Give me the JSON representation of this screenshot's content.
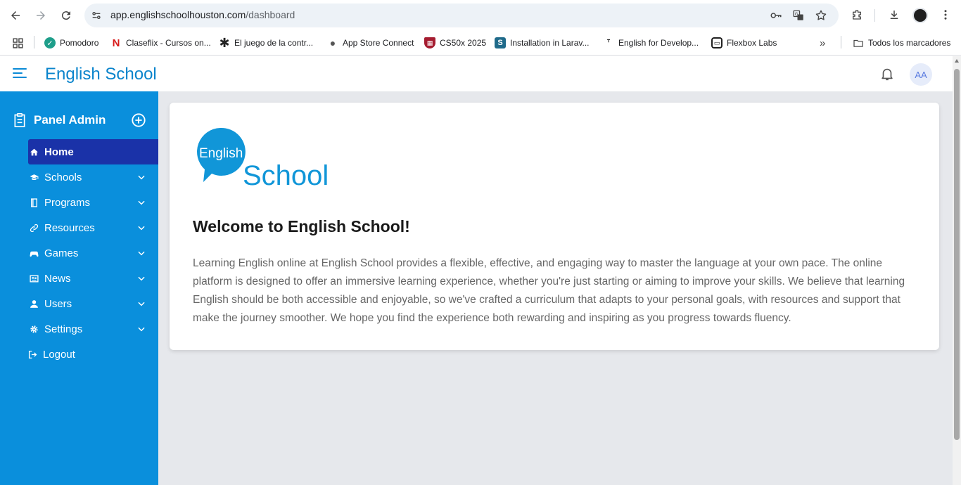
{
  "browser": {
    "url_host": "app.englishschoolhouston.com",
    "url_path": "/dashboard",
    "bookmarks": [
      {
        "label": "Pomodoro",
        "icon": "check-circle-icon",
        "color": "#1e9e8a"
      },
      {
        "label": "Claseflix - Cursos on...",
        "icon": "claseflix-icon",
        "color": "#d81b1b"
      },
      {
        "label": "El juego de la contr...",
        "icon": "asterisk-icon",
        "color": "#222222"
      },
      {
        "label": "App Store Connect",
        "icon": "apple-icon",
        "color": "#555555"
      },
      {
        "label": "CS50x 2025",
        "icon": "harvard-shield-icon",
        "color": "#a51c30"
      },
      {
        "label": "Installation in Larav...",
        "icon": "s-square-icon",
        "color": "#1f6a8a"
      },
      {
        "label": "English for Develop...",
        "icon": "t-pin-icon",
        "color": "#222222"
      },
      {
        "label": "Flexbox Labs",
        "icon": "flexbox-icon",
        "color": "#222222"
      }
    ],
    "all_bookmarks_label": "Todos los marcadores"
  },
  "header": {
    "brand": "English School",
    "avatar_initials": "AA"
  },
  "sidebar": {
    "title": "Panel Admin",
    "items": [
      {
        "label": "Home",
        "icon": "home-icon",
        "active": true
      },
      {
        "label": "Schools",
        "icon": "graduation-cap-icon"
      },
      {
        "label": "Programs",
        "icon": "book-icon"
      },
      {
        "label": "Resources",
        "icon": "link-icon"
      },
      {
        "label": "Games",
        "icon": "gamepad-icon"
      },
      {
        "label": "News",
        "icon": "newspaper-icon"
      },
      {
        "label": "Users",
        "icon": "user-icon"
      },
      {
        "label": "Settings",
        "icon": "gear-icon"
      },
      {
        "label": "Logout",
        "icon": "logout-icon"
      }
    ]
  },
  "main": {
    "logo_top": "English",
    "logo_bottom": "School",
    "welcome": "Welcome to English School!",
    "description": "Learning English online at English School provides a flexible, effective, and engaging way to master the language at your own pace. The online platform is designed to offer an immersive learning experience, whether you're just starting or aiming to improve your skills. We believe that learning English should be both accessible and enjoyable, so we've crafted a curriculum that adapts to your personal goals, with resources and support that make the journey smoother. We hope you find the experience both rewarding and inspiring as you progress towards fluency."
  },
  "colors": {
    "sidebar": "#0a8fdc",
    "active_item": "#1a32a8",
    "brand": "#0a84cc"
  }
}
